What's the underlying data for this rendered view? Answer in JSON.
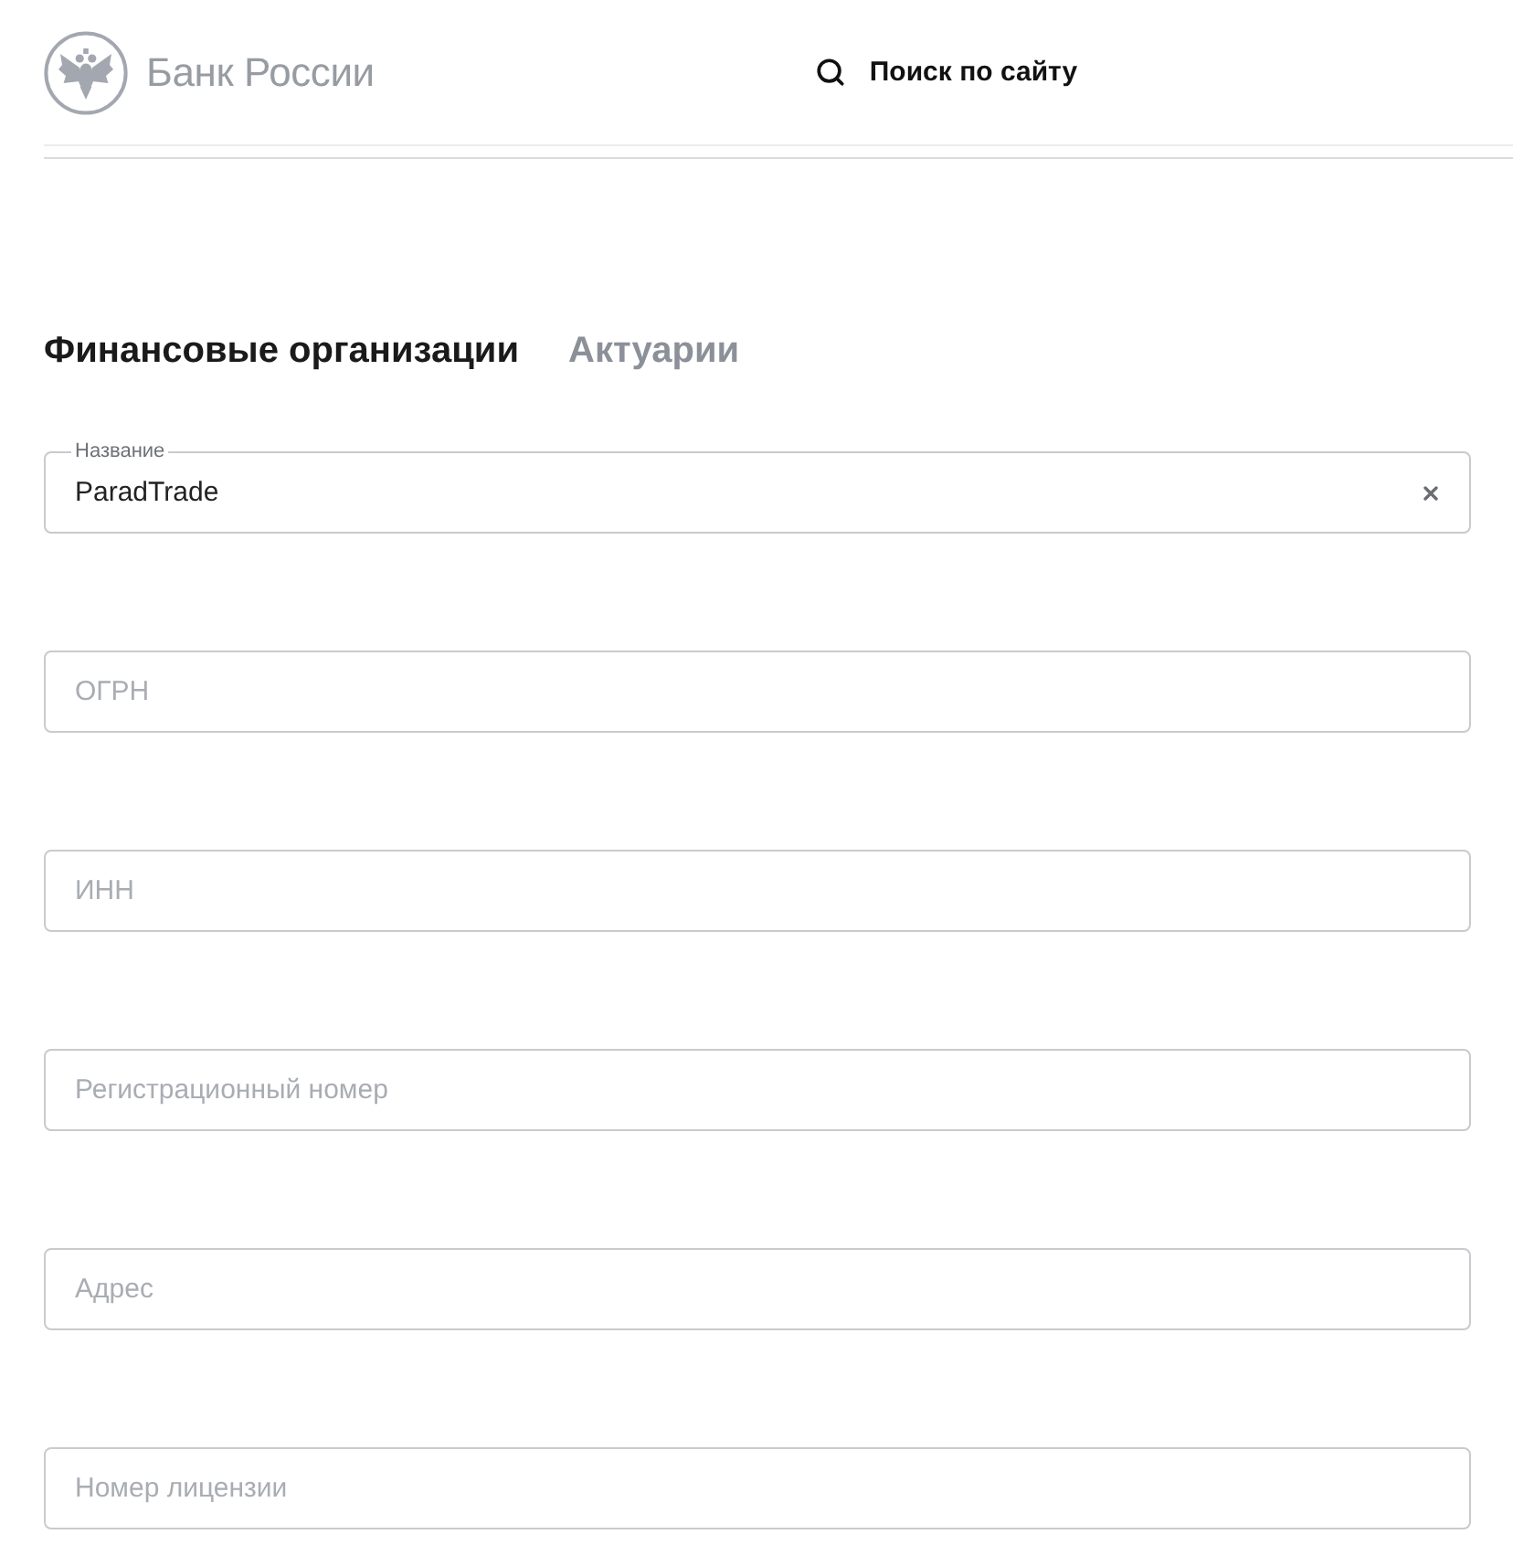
{
  "header": {
    "logo_text": "Банк России",
    "search_label": "Поиск по сайту"
  },
  "tabs": [
    {
      "label": "Финансовые организации",
      "selected": true
    },
    {
      "label": "Актуарии",
      "selected": false
    }
  ],
  "fields": [
    {
      "label": "Название",
      "value": "ParadTrade"
    },
    {
      "placeholder": "ОГРН"
    },
    {
      "placeholder": "ИНН"
    },
    {
      "placeholder": "Регистрационный номер"
    },
    {
      "placeholder": "Адрес"
    },
    {
      "placeholder": "Номер лицензии"
    }
  ]
}
